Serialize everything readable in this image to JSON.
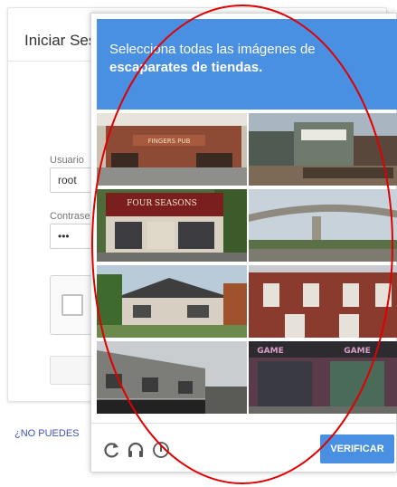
{
  "login": {
    "title": "Iniciar Ses",
    "username_label": "Usuario",
    "username_value": "root",
    "password_label": "Contrase",
    "password_value": "•••",
    "forgot_link": "¿NO PUEDES"
  },
  "captcha": {
    "instruction_line1": "Selecciona todas las imágenes de",
    "instruction_line2": "escaparates de tiendas.",
    "verify_label": "VERIFICAR",
    "accent_color": "#4a90e2",
    "tiles": [
      {
        "name": "captcha-tile-1",
        "content": "storefront",
        "sign_text": "FINGERS PUB"
      },
      {
        "name": "captcha-tile-2",
        "content": "storefront"
      },
      {
        "name": "captcha-tile-3",
        "content": "storefront",
        "sign_text": "FOUR SEASONS"
      },
      {
        "name": "captcha-tile-4",
        "content": "bridge"
      },
      {
        "name": "captcha-tile-5",
        "content": "house"
      },
      {
        "name": "captcha-tile-6",
        "content": "brick-building"
      },
      {
        "name": "captcha-tile-7",
        "content": "building"
      },
      {
        "name": "captcha-tile-8",
        "content": "storefront",
        "sign_text": "GAME"
      }
    ],
    "footer_icons": [
      "reload-icon",
      "audio-icon",
      "info-icon"
    ]
  },
  "annotation": {
    "shape": "red-oval",
    "color": "#e00000"
  }
}
